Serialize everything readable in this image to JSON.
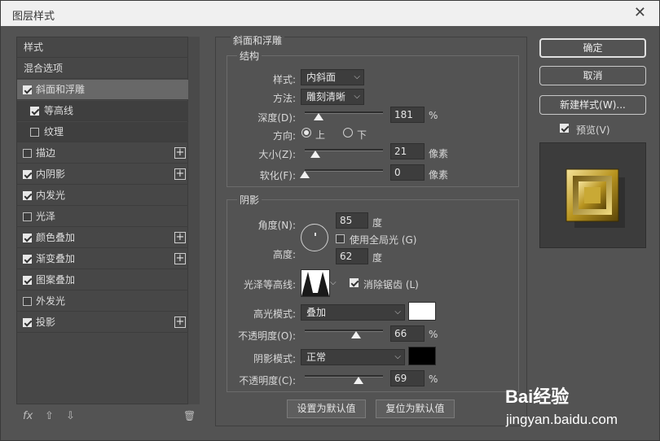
{
  "window": {
    "title": "图层样式",
    "close_glyph": "✕"
  },
  "sidebar": {
    "items": [
      {
        "label": "样式",
        "checkbox": false,
        "checked": false,
        "plus": false,
        "selected": false,
        "sub": false
      },
      {
        "label": "混合选项",
        "checkbox": false,
        "checked": false,
        "plus": false,
        "selected": false,
        "sub": false
      },
      {
        "label": "斜面和浮雕",
        "checkbox": true,
        "checked": true,
        "plus": false,
        "selected": true,
        "sub": false
      },
      {
        "label": "等高线",
        "checkbox": true,
        "checked": true,
        "plus": false,
        "selected": false,
        "sub": true
      },
      {
        "label": "纹理",
        "checkbox": true,
        "checked": false,
        "plus": false,
        "selected": false,
        "sub": true
      },
      {
        "label": "描边",
        "checkbox": true,
        "checked": false,
        "plus": true,
        "selected": false,
        "sub": false
      },
      {
        "label": "内阴影",
        "checkbox": true,
        "checked": true,
        "plus": true,
        "selected": false,
        "sub": false
      },
      {
        "label": "内发光",
        "checkbox": true,
        "checked": true,
        "plus": false,
        "selected": false,
        "sub": false
      },
      {
        "label": "光泽",
        "checkbox": true,
        "checked": false,
        "plus": false,
        "selected": false,
        "sub": false
      },
      {
        "label": "颜色叠加",
        "checkbox": true,
        "checked": true,
        "plus": true,
        "selected": false,
        "sub": false
      },
      {
        "label": "渐变叠加",
        "checkbox": true,
        "checked": true,
        "plus": true,
        "selected": false,
        "sub": false
      },
      {
        "label": "图案叠加",
        "checkbox": true,
        "checked": true,
        "plus": false,
        "selected": false,
        "sub": false
      },
      {
        "label": "外发光",
        "checkbox": true,
        "checked": false,
        "plus": false,
        "selected": false,
        "sub": false
      },
      {
        "label": "投影",
        "checkbox": true,
        "checked": true,
        "plus": true,
        "selected": false,
        "sub": false
      }
    ],
    "footer": {
      "fx": "fx",
      "up": "⇧",
      "down": "⇩",
      "trash": "🗑"
    }
  },
  "bevel": {
    "section_title": "斜面和浮雕",
    "structure_title": "结构",
    "style_label": "样式:",
    "style_value": "内斜面",
    "technique_label": "方法:",
    "technique_value": "雕刻清晰",
    "depth_label": "深度(D):",
    "depth_value": "181",
    "depth_unit": "%",
    "depth_level": 0.18,
    "direction_label": "方向:",
    "direction_up": "上",
    "direction_down": "下",
    "size_label": "大小(Z):",
    "size_value": "21",
    "size_unit": "像素",
    "size_level": 0.14,
    "soften_label": "软化(F):",
    "soften_value": "0",
    "soften_unit": "像素",
    "soften_level": 0.0
  },
  "shading": {
    "title": "阴影",
    "angle_label": "角度(N):",
    "angle_value": "85",
    "angle_unit": "度",
    "global_light_label": "使用全局光 (G)",
    "global_light_checked": false,
    "altitude_label": "高度:",
    "altitude_value": "62",
    "altitude_unit": "度",
    "gloss_label": "光泽等高线:",
    "antialias_label": "消除锯齿 (L)",
    "antialias_checked": true,
    "highlight_mode_label": "高光模式:",
    "highlight_mode_value": "叠加",
    "highlight_color": "#ffffff",
    "highlight_opacity_label": "不透明度(O):",
    "highlight_opacity_value": "66",
    "highlight_opacity_unit": "%",
    "highlight_opacity_level": 0.66,
    "shadow_mode_label": "阴影模式:",
    "shadow_mode_value": "正常",
    "shadow_color": "#000000",
    "shadow_opacity_label": "不透明度(C):",
    "shadow_opacity_value": "69",
    "shadow_opacity_unit": "%",
    "shadow_opacity_level": 0.69
  },
  "bottom_buttons": {
    "set_default": "设置为默认值",
    "reset_default": "复位为默认值"
  },
  "right": {
    "ok": "确定",
    "cancel": "取消",
    "new_style": "新建样式(W)...",
    "preview_label": "预览(V)",
    "preview_checked": true
  },
  "watermark": {
    "brand": "Bai经验",
    "url": "jingyan.baidu.com"
  },
  "colors": {
    "dialog_bg": "#535353",
    "gold_light": "#e8d27a",
    "gold_dark": "#6b5410"
  }
}
